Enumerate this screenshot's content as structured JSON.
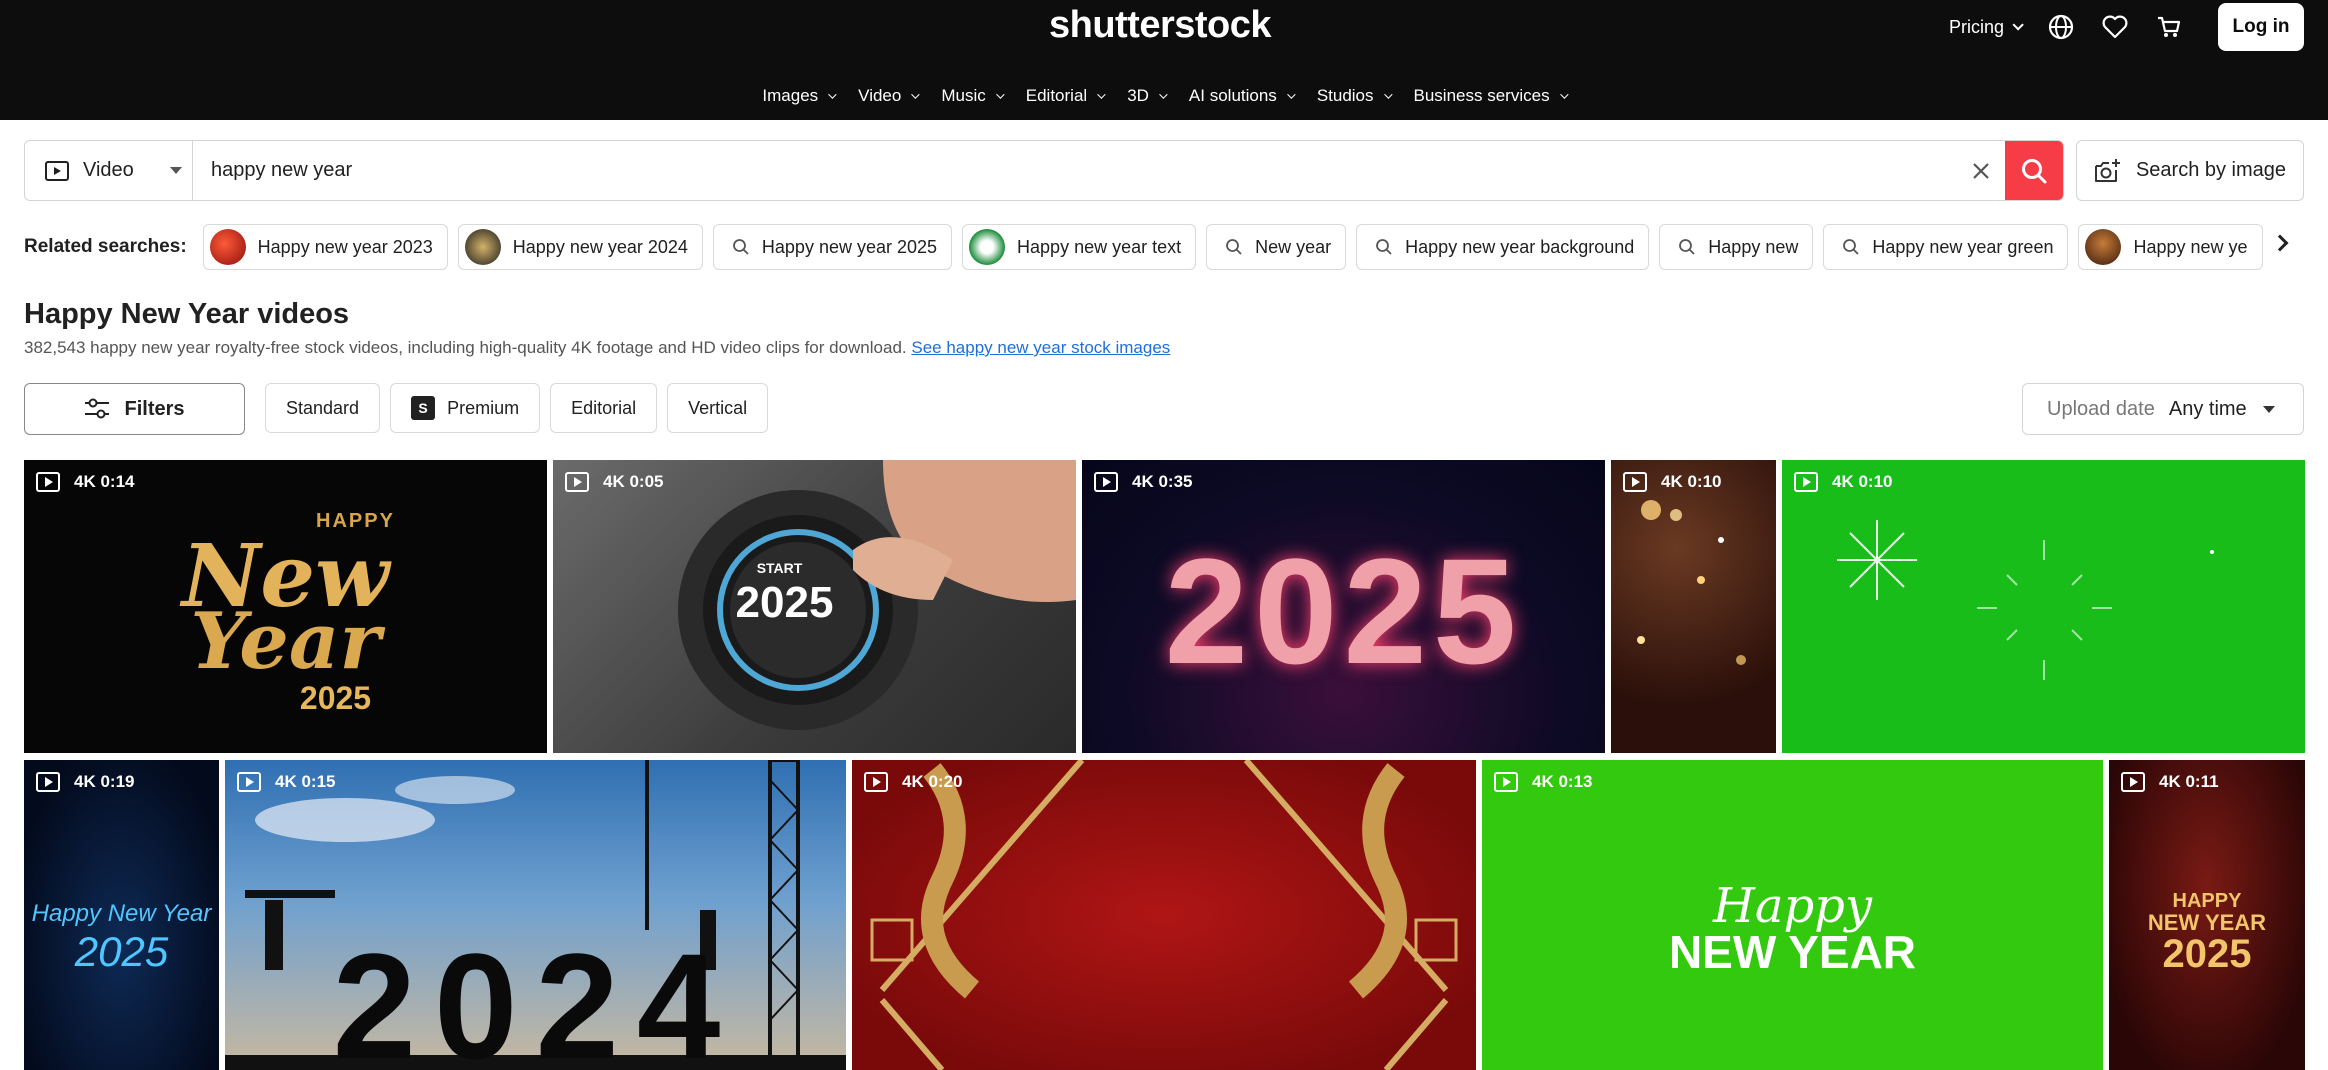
{
  "header": {
    "logo": "shutterstock",
    "pricing": "Pricing",
    "login": "Log in",
    "icons": [
      "globe-icon",
      "heart-icon",
      "cart-icon"
    ]
  },
  "nav": [
    "Images",
    "Video",
    "Music",
    "Editorial",
    "3D",
    "AI solutions",
    "Studios",
    "Business services"
  ],
  "search": {
    "type": "Video",
    "query": "happy new year",
    "by_image": "Search by image",
    "accent": "#f63c47"
  },
  "related": {
    "label": "Related searches:",
    "chips": [
      "Happy new year 2023",
      "Happy new year 2024",
      "Happy new year 2025",
      "Happy new year text",
      "New year",
      "Happy new year background",
      "Happy new",
      "Happy new year green",
      "Happy new ye"
    ]
  },
  "heading": {
    "title": "Happy New Year videos",
    "subtitle": "382,543 happy new year royalty-free stock videos, including high-quality 4K footage and HD video clips for download.",
    "link": "See happy new year stock images"
  },
  "filters": {
    "filters_btn": "Filters",
    "chips": [
      "Standard",
      "Premium",
      "Editorial",
      "Vertical"
    ],
    "premium_badge": "S",
    "upload_label": "Upload date",
    "upload_value": "Any time"
  },
  "videos": [
    {
      "badge": "4K 0:14",
      "line1": "HAPPY",
      "line2": "New",
      "line3": "Year",
      "line4": "2025"
    },
    {
      "badge": "4K 0:05",
      "line1": "START",
      "line2": "2025"
    },
    {
      "badge": "4K 0:35",
      "line1": "2025"
    },
    {
      "badge": "4K 0:10"
    },
    {
      "badge": "4K 0:10"
    },
    {
      "badge": "4K 0:19",
      "line1": "Happy New Year",
      "line2": "2025"
    },
    {
      "badge": "4K 0:15",
      "line1": "2024"
    },
    {
      "badge": "4K 0:20"
    },
    {
      "badge": "4K 0:13",
      "line1": "Happy",
      "line2": "NEW YEAR"
    },
    {
      "badge": "4K 0:11",
      "line1": "HAPPY",
      "line2": "NEW YEAR",
      "line3": "2025"
    }
  ]
}
